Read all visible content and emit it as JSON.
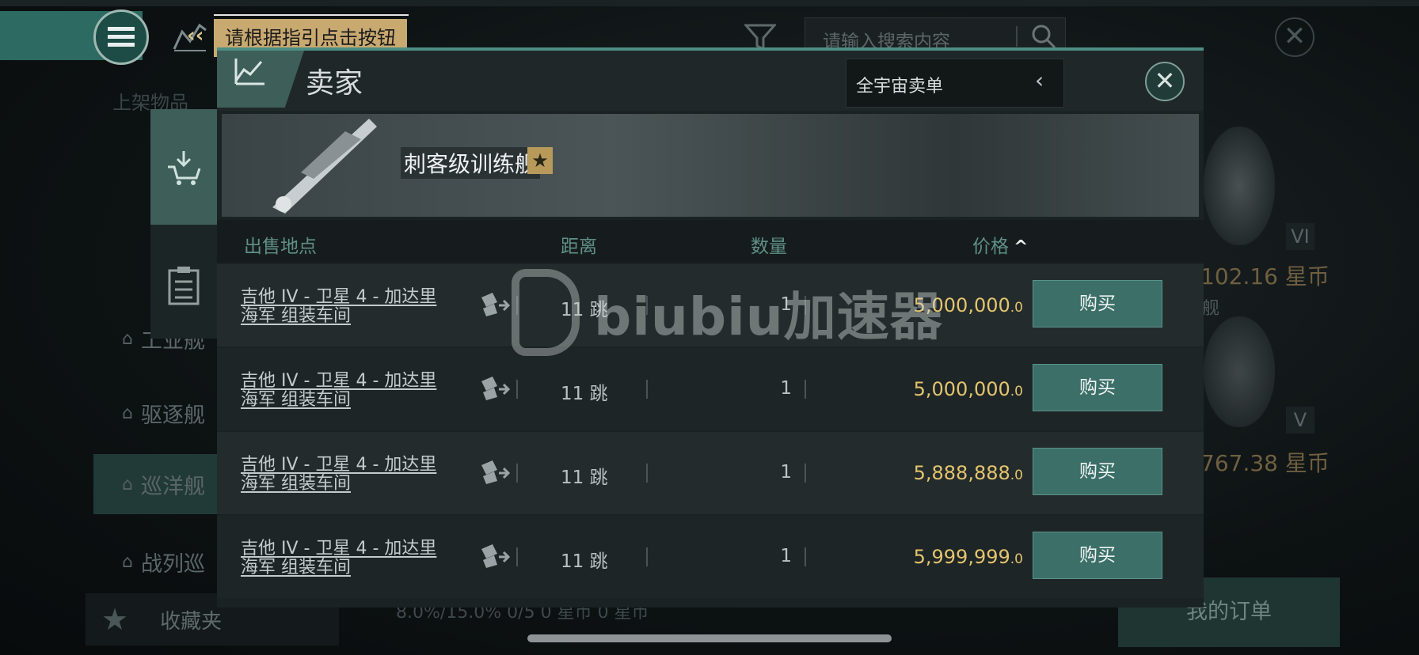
{
  "tooltip": {
    "text": "请根据指引点击按钮"
  },
  "search": {
    "placeholder": "请输入搜索内容"
  },
  "sidebar": {
    "title": "上架物品",
    "items": [
      {
        "label": "工业舰"
      },
      {
        "label": "驱逐舰"
      },
      {
        "label": "巡洋舰"
      },
      {
        "label": "战列巡"
      }
    ],
    "favorites": "收藏夹"
  },
  "background": {
    "tier1": "VI",
    "price1": "102.16 星币",
    "label1": "舰",
    "tier2": "V",
    "price2": "767.38 星币",
    "stats": "8.0%/15.0%    0/5    0 星币    0 星币",
    "my_orders": "我的订单"
  },
  "modal": {
    "title": "卖家",
    "dropdown": "全宇宙卖单",
    "ship_name": "刺客级训练舰",
    "columns": {
      "location": "出售地点",
      "distance": "距离",
      "quantity": "数量",
      "price": "价格"
    },
    "rows": [
      {
        "location": "吉他 IV - 卫星 4 - 加达里海军 组装车间",
        "distance": "11 跳",
        "quantity": "1",
        "price": "5,000,000",
        "price_dec": ".0",
        "buy": "购买"
      },
      {
        "location": "吉他 IV - 卫星 4 - 加达里海军 组装车间",
        "distance": "11 跳",
        "quantity": "1",
        "price": "5,000,000",
        "price_dec": ".0",
        "buy": "购买"
      },
      {
        "location": "吉他 IV - 卫星 4 - 加达里海军 组装车间",
        "distance": "11 跳",
        "quantity": "1",
        "price": "5,888,888",
        "price_dec": ".0",
        "buy": "购买"
      },
      {
        "location": "吉他 IV - 卫星 4 - 加达里海军 组装车间",
        "distance": "11 跳",
        "quantity": "1",
        "price": "5,999,999",
        "price_dec": ".0",
        "buy": "购买"
      }
    ]
  },
  "watermark": {
    "text": "biubiu加速器"
  },
  "colors": {
    "accent": "#3b6f68",
    "price": "#e4c46e",
    "tooltip": "#c8a970"
  }
}
